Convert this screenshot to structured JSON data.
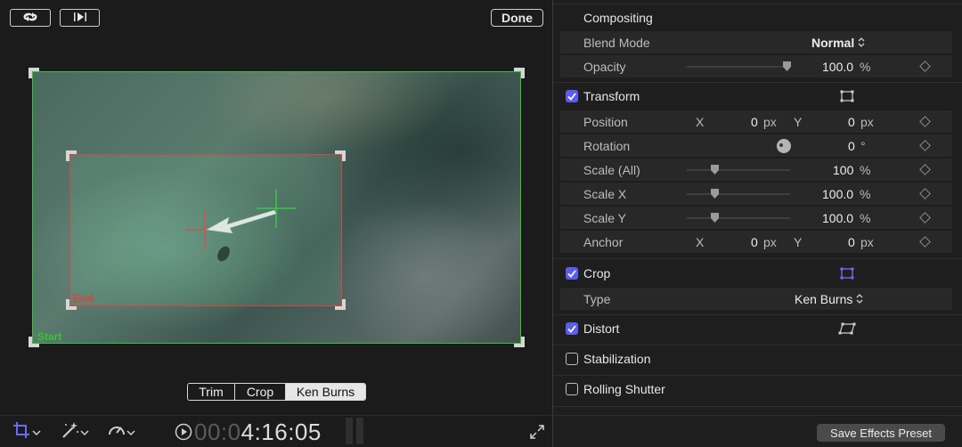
{
  "viewer": {
    "done_label": "Done",
    "start_label": "Start",
    "end_label": "End",
    "modes": [
      "Trim",
      "Crop",
      "Ken Burns"
    ],
    "selected_mode": "Ken Burns",
    "timecode_dim": "00:0",
    "timecode_bright": "4:16:05"
  },
  "inspector": {
    "compositing": {
      "title": "Compositing",
      "blend_mode_label": "Blend Mode",
      "blend_mode_value": "Normal",
      "opacity_label": "Opacity",
      "opacity_value": "100.0",
      "opacity_unit": "%"
    },
    "transform": {
      "title": "Transform",
      "enabled": true,
      "position_label": "Position",
      "position_x": "0",
      "position_y": "0",
      "position_unit": "px",
      "axis_x": "X",
      "axis_y": "Y",
      "rotation_label": "Rotation",
      "rotation_value": "0",
      "rotation_unit": "°",
      "scale_all_label": "Scale (All)",
      "scale_all_value": "100",
      "scale_x_label": "Scale X",
      "scale_x_value": "100.0",
      "scale_y_label": "Scale Y",
      "scale_y_value": "100.0",
      "scale_unit": "%",
      "anchor_label": "Anchor",
      "anchor_x": "0",
      "anchor_y": "0",
      "anchor_unit": "px"
    },
    "crop": {
      "title": "Crop",
      "enabled": true,
      "type_label": "Type",
      "type_value": "Ken Burns"
    },
    "distort": {
      "title": "Distort",
      "enabled": true
    },
    "stabilization": {
      "title": "Stabilization",
      "enabled": false
    },
    "rolling_shutter": {
      "title": "Rolling Shutter",
      "enabled": false
    },
    "save_preset_label": "Save Effects Preset"
  },
  "colors": {
    "accent": "#5b5cf0",
    "start_green": "#35c437",
    "end_red": "#e2403f"
  },
  "icons": [
    "swap-arrows-icon",
    "play-to-end-icon",
    "crop-tool-icon",
    "magic-wand-icon",
    "speed-gauge-icon",
    "play-circle-icon",
    "fullscreen-icon",
    "transform-handles-icon",
    "crop-handles-icon",
    "distort-handles-icon",
    "keyframe-diamond-icon",
    "rotation-dial-icon",
    "stepper-icon"
  ]
}
